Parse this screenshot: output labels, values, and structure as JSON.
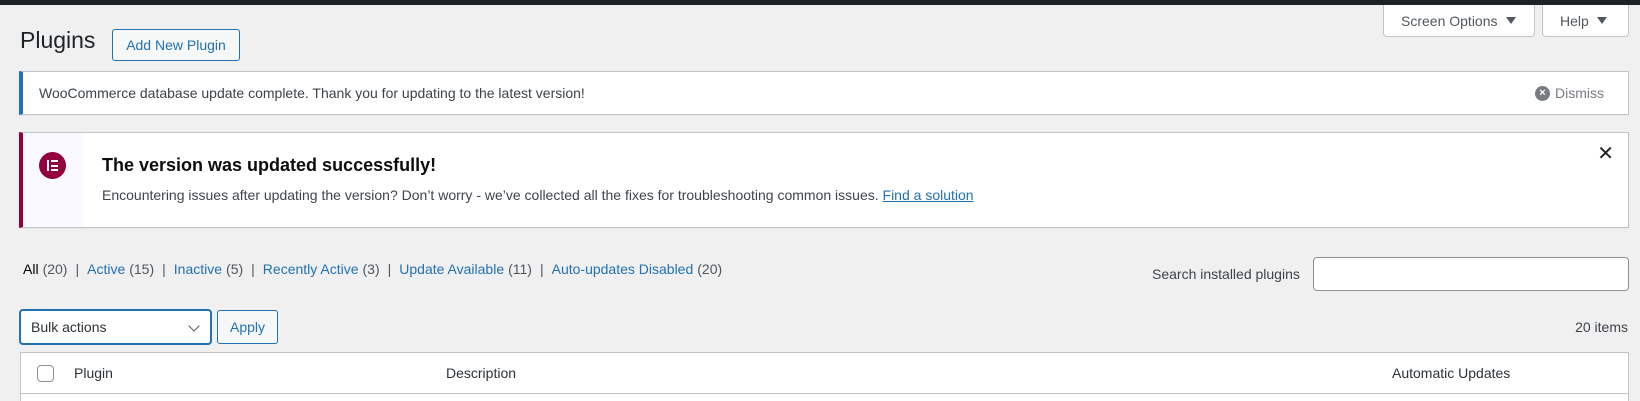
{
  "header": {
    "screen_options_label": "Screen Options",
    "help_label": "Help",
    "page_title": "Plugins",
    "add_new_label": "Add New Plugin"
  },
  "notices": {
    "woo": {
      "message": "WooCommerce database update complete. Thank you for updating to the latest version!",
      "dismiss_label": "Dismiss"
    },
    "elementor": {
      "title": "The version was updated successfully!",
      "description": "Encountering issues after updating the version? Don’t worry - we’ve collected all the fixes for troubleshooting common issues.",
      "link_label": "Find a solution",
      "close_glyph": "✕"
    }
  },
  "filters": [
    {
      "label": "All",
      "count": "(20)",
      "current": true
    },
    {
      "label": "Active",
      "count": "(15)"
    },
    {
      "label": "Inactive",
      "count": "(5)"
    },
    {
      "label": "Recently Active",
      "count": "(3)"
    },
    {
      "label": "Update Available",
      "count": "(11)"
    },
    {
      "label": "Auto-updates Disabled",
      "count": "(20)"
    }
  ],
  "filter_separator": "|",
  "search": {
    "label": "Search installed plugins",
    "value": ""
  },
  "bulk": {
    "selected": "Bulk actions",
    "apply_label": "Apply",
    "items_count": "20 items"
  },
  "table": {
    "columns": [
      "Plugin",
      "Description",
      "Automatic Updates"
    ]
  },
  "colors": {
    "accent": "#2271b1",
    "elementor_brand": "#93003f",
    "background": "#f0f0f1"
  }
}
